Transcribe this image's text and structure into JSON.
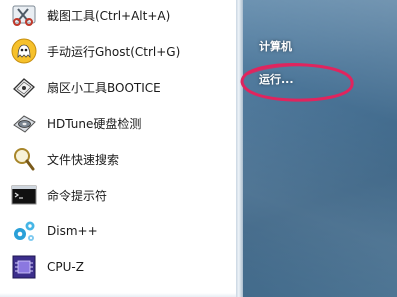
{
  "left_menu": {
    "items": [
      {
        "label": "截图工具(Ctrl+Alt+A)",
        "icon": "scissors-icon"
      },
      {
        "label": "手动运行Ghost(Ctrl+G)",
        "icon": "ghost-icon"
      },
      {
        "label": "扇区小工具BOOTICE",
        "icon": "disk-tool-icon"
      },
      {
        "label": "HDTune硬盘检测",
        "icon": "hard-disk-icon"
      },
      {
        "label": "文件快速搜索",
        "icon": "magnifier-icon"
      },
      {
        "label": "命令提示符",
        "icon": "command-prompt-icon"
      },
      {
        "label": "Dism++",
        "icon": "gears-icon"
      },
      {
        "label": "CPU-Z",
        "icon": "cpu-icon"
      }
    ]
  },
  "right_menu": {
    "items": [
      {
        "label": "计算机"
      },
      {
        "label": "运行..."
      }
    ]
  },
  "colors": {
    "highlight_ellipse": "#e0245e",
    "right_pane": "#4b7598"
  }
}
